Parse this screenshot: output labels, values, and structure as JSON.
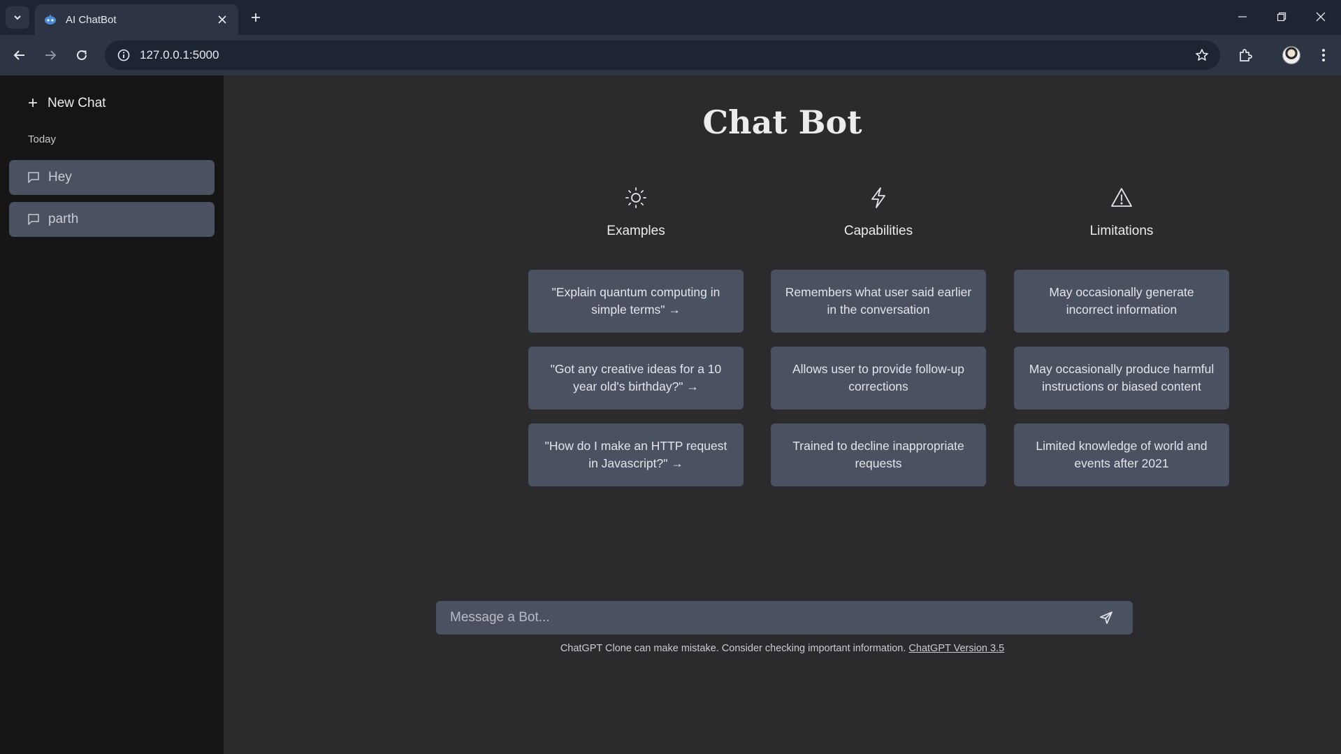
{
  "browser": {
    "tab_title": "AI ChatBot",
    "url": "127.0.0.1:5000"
  },
  "sidebar": {
    "new_chat_label": "New Chat",
    "section_label": "Today",
    "history": [
      {
        "label": "Hey"
      },
      {
        "label": "parth"
      }
    ]
  },
  "main": {
    "title": "Chat Bot",
    "columns": [
      {
        "icon": "sun-icon",
        "title": "Examples",
        "cards": [
          "\"Explain quantum computing in simple terms\" →",
          "\"Got any creative ideas for a 10 year old's birthday?\" →",
          "\"How do I make an HTTP request in Javascript?\" →"
        ]
      },
      {
        "icon": "lightning-icon",
        "title": "Capabilities",
        "cards": [
          "Remembers what user said earlier in the conversation",
          "Allows user to provide follow-up corrections",
          "Trained to decline inappropriate requests"
        ]
      },
      {
        "icon": "warning-icon",
        "title": "Limitations",
        "cards": [
          "May occasionally generate incorrect information",
          "May occasionally produce harmful instructions or biased content",
          "Limited knowledge of world and events after 2021"
        ]
      }
    ],
    "composer": {
      "placeholder": "Message a Bot...",
      "value": ""
    },
    "footnote": {
      "text": "ChatGPT Clone can make mistake. Consider checking important information.",
      "link_label": "ChatGPT Version 3.5"
    }
  },
  "colors": {
    "sidebar_bg": "#151516",
    "main_bg": "#2b2b2d",
    "card_bg": "#4a5160",
    "chrome_bg": "#1e2532"
  }
}
